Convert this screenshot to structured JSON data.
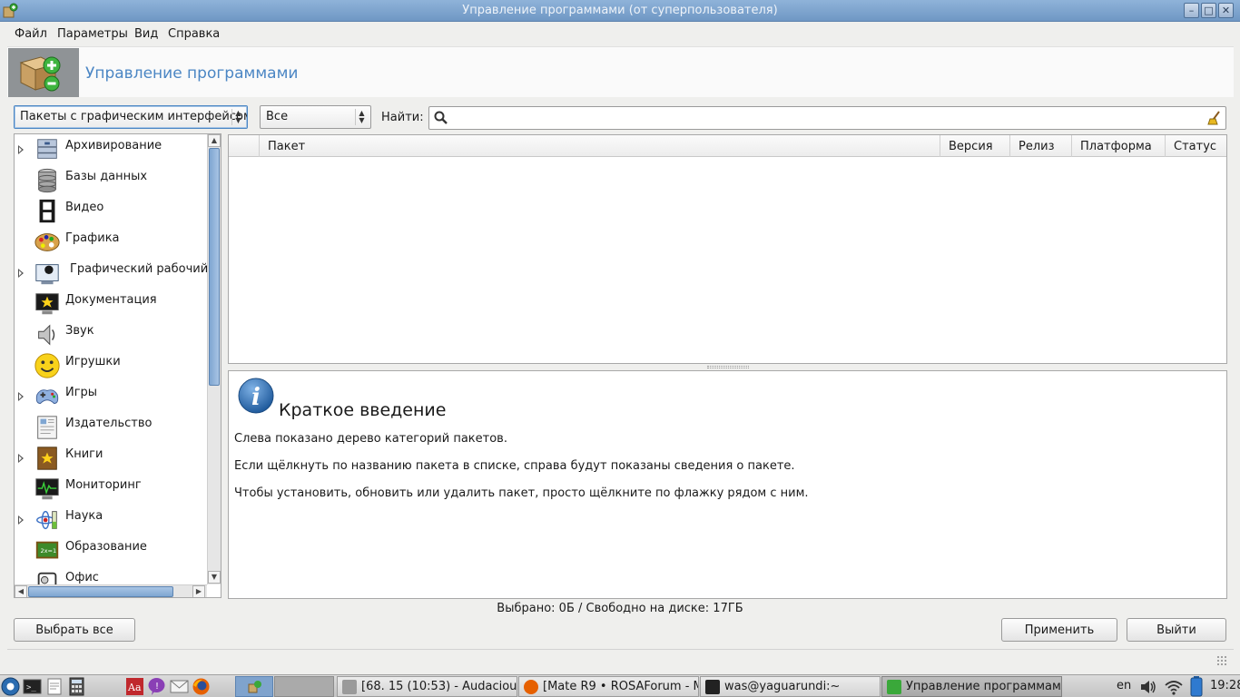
{
  "window": {
    "title": "Управление программами (от суперпользователя)"
  },
  "menu": [
    "Файл",
    "Параметры",
    "Вид",
    "Справка"
  ],
  "header": {
    "title": "Управление программами"
  },
  "filters": {
    "type_selected": "Пакеты с графическим интерфейсом",
    "status_selected": "Все",
    "find_label": "Найти:",
    "search_value": ""
  },
  "categories": [
    {
      "label": "Архивирование",
      "expandable": true,
      "icon": "archive-icon"
    },
    {
      "label": "Базы данных",
      "expandable": false,
      "icon": "database-icon"
    },
    {
      "label": "Видео",
      "expandable": false,
      "icon": "video-icon"
    },
    {
      "label": "Графика",
      "expandable": false,
      "icon": "palette-icon"
    },
    {
      "label": "Графический рабочий с",
      "expandable": true,
      "icon": "desktop-icon"
    },
    {
      "label": "Документация",
      "expandable": false,
      "icon": "documentation-icon"
    },
    {
      "label": "Звук",
      "expandable": false,
      "icon": "speaker-icon"
    },
    {
      "label": "Игрушки",
      "expandable": false,
      "icon": "smiley-icon"
    },
    {
      "label": "Игры",
      "expandable": true,
      "icon": "gamepad-icon"
    },
    {
      "label": "Издательство",
      "expandable": false,
      "icon": "publishing-icon"
    },
    {
      "label": "Книги",
      "expandable": true,
      "icon": "book-icon"
    },
    {
      "label": "Мониторинг",
      "expandable": false,
      "icon": "monitor-icon"
    },
    {
      "label": "Наука",
      "expandable": true,
      "icon": "science-icon"
    },
    {
      "label": "Образование",
      "expandable": false,
      "icon": "chalkboard-icon"
    },
    {
      "label": "Офис",
      "expandable": false,
      "icon": "office-icon"
    }
  ],
  "table": {
    "columns": [
      "Пакет",
      "Версия",
      "Релиз",
      "Платформа",
      "Статус"
    ],
    "rows": []
  },
  "info": {
    "title": "Краткое введение",
    "paragraphs": [
      "Слева показано дерево категорий пакетов.",
      "Если щёлкнуть по названию пакета в списке, справа будут показаны сведения о пакете.",
      "Чтобы установить, обновить или удалить пакет, просто щёлкните по флажку рядом с ним."
    ]
  },
  "status_text": "Выбрано: 0Б / Свободно на диске: 17ГБ",
  "buttons": {
    "select_all": "Выбрать все",
    "apply": "Применить",
    "quit": "Выйти"
  },
  "taskbar": {
    "tasks": [
      {
        "label": "[68. 15 (10:53) - Audacious]",
        "active": false
      },
      {
        "label": "[Mate R9 • ROSAForum - M...",
        "active": false
      },
      {
        "label": "was@yaguarundi:~",
        "active": false
      },
      {
        "label": "Управление программам...",
        "active": true
      }
    ],
    "lang": "en",
    "time": "19:28"
  },
  "colors": {
    "accent": "#4b86c4",
    "titlebar": "#7fa3cd"
  }
}
